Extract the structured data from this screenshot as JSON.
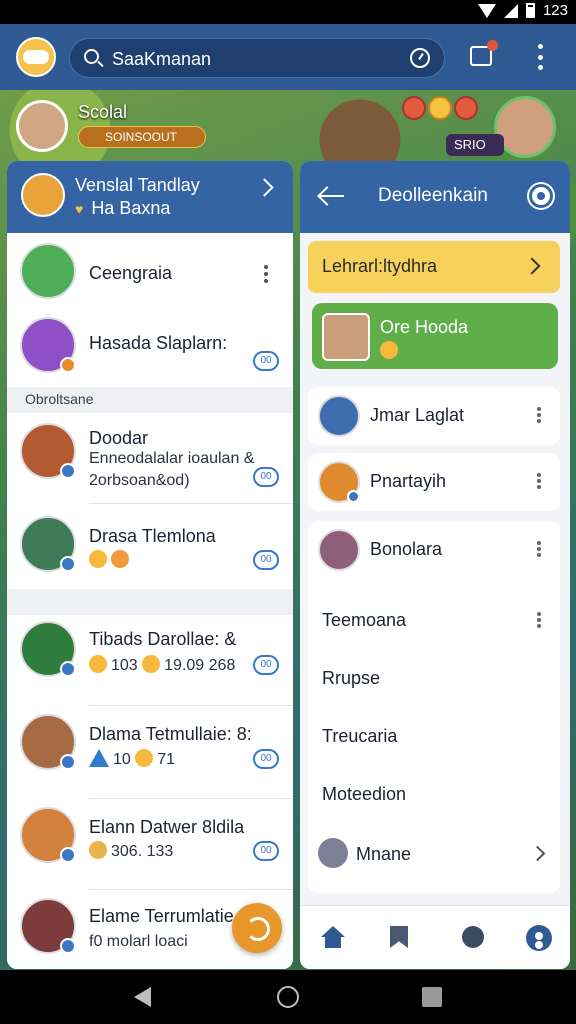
{
  "status": {
    "time": "123"
  },
  "appbar": {
    "search_text": "SaaKmanan"
  },
  "game": {
    "player_name": "Scolal",
    "player_badge": "SOINSOOUT",
    "opponent_badge": "SRIO"
  },
  "left_panel": {
    "header": {
      "title": "Venslal Tandlay",
      "subtitle": "Ha Baxna"
    },
    "section_label": "Obroltsane",
    "chats": [
      {
        "name": "Ceengraia"
      },
      {
        "name": "Hasada Slaplarn:",
        "ring": "00"
      },
      {
        "name": "Doodar",
        "line1": "Enneodalalar ioaulan &",
        "line2": "2orbsoan&od)",
        "ring": "00"
      },
      {
        "name": "Drasa Tlemlona",
        "ring": "00"
      },
      {
        "name": "Tibads Darollae: &",
        "meta": "103",
        "meta2": "19.09 268",
        "ring": "00"
      },
      {
        "name": "Dlama Tetmullaie: 8:",
        "meta": "10",
        "meta2": "71",
        "ring": "00"
      },
      {
        "name": "Elann Datwer 8ldila",
        "meta": "306. 133",
        "ring": "00"
      },
      {
        "name": "Elame Terrumlatie",
        "meta": "f0 molarl loaci"
      }
    ]
  },
  "right_panel": {
    "header": {
      "title": "Deolleenkain"
    },
    "yellow_card": "Lehrarl:ltydhra",
    "green_card": "Ore Hooda",
    "friends": [
      {
        "name": "Jmar Laglat"
      },
      {
        "name": "Pnartayih"
      },
      {
        "name": "Bonolara"
      }
    ],
    "menu": [
      "Teemoana",
      "Rrupse",
      "Treucaria",
      "Moteedion"
    ],
    "manage_label": "Mnane"
  },
  "colors": {
    "primary": "#3464a3",
    "appbar": "#2f5a93",
    "accent_yellow": "#f6d15b",
    "accent_green": "#5fae4a",
    "fab": "#e7972b"
  },
  "icons": [
    "search-icon",
    "clock-icon",
    "notification-icon",
    "more-icon",
    "chevron-right-icon",
    "back-arrow-icon",
    "gear-icon",
    "home-icon",
    "bookmark-icon",
    "chat-icon",
    "profile-icon",
    "refresh-icon"
  ]
}
